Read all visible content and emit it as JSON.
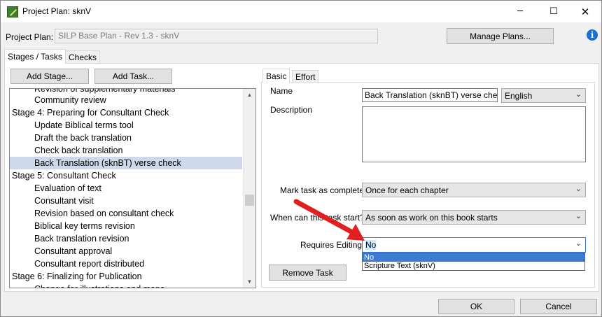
{
  "window": {
    "title": "Project Plan: sknV",
    "minimize": "─",
    "maximize": "☐",
    "close": "✕"
  },
  "project_plan": {
    "label": "Project Plan:",
    "value": "SILP Base Plan - Rev 1.3 - sknV",
    "manage_button": "Manage Plans...",
    "info_icon": "i"
  },
  "tabs": [
    {
      "label": "Stages / Tasks",
      "active": true
    },
    {
      "label": "Checks",
      "active": false
    }
  ],
  "toolbar": {
    "add_stage": "Add Stage...",
    "add_task": "Add Task..."
  },
  "tree": {
    "rows": [
      {
        "label": "Revision of supplementary materials",
        "level": 1,
        "selected": false
      },
      {
        "label": "Community review",
        "level": 1,
        "selected": false
      },
      {
        "label": "Stage 4: Preparing for Consultant Check",
        "level": 0,
        "selected": false
      },
      {
        "label": "Update Biblical terms tool",
        "level": 1,
        "selected": false
      },
      {
        "label": "Draft the back translation",
        "level": 1,
        "selected": false
      },
      {
        "label": "Check back translation",
        "level": 1,
        "selected": false
      },
      {
        "label": "Back Translation (sknBT) verse check",
        "level": 1,
        "selected": true
      },
      {
        "label": "Stage 5: Consultant Check",
        "level": 0,
        "selected": false
      },
      {
        "label": "Evaluation of text",
        "level": 1,
        "selected": false
      },
      {
        "label": "Consultant visit",
        "level": 1,
        "selected": false
      },
      {
        "label": "Revision based on consultant check",
        "level": 1,
        "selected": false
      },
      {
        "label": "Biblical key terms revision",
        "level": 1,
        "selected": false
      },
      {
        "label": "Back translation revision",
        "level": 1,
        "selected": false
      },
      {
        "label": "Consultant approval",
        "level": 1,
        "selected": false
      },
      {
        "label": "Consultant report distributed",
        "level": 1,
        "selected": false
      },
      {
        "label": "Stage 6: Finalizing for Publication",
        "level": 0,
        "selected": false
      },
      {
        "label": "Change for illustrations and maps",
        "level": 1,
        "selected": false
      }
    ],
    "scroll_up": "▲",
    "scroll_down": "▼"
  },
  "detail_tabs": [
    {
      "label": "Basic",
      "active": true
    },
    {
      "label": "Effort",
      "active": false
    }
  ],
  "detail": {
    "name_label": "Name",
    "name_value": "Back Translation (sknBT) verse check",
    "language_value": "English",
    "description_label": "Description",
    "description_value": "",
    "mark_complete_label": "Mark task as complete",
    "mark_complete_value": "Once for each chapter",
    "start_label": "When can this task start?",
    "start_value": "As soon as work on this book starts",
    "requires_editing_label": "Requires Editing",
    "requires_editing_value": "No",
    "requires_editing_options": [
      "No",
      "Scripture Text (sknV)"
    ],
    "remove_task": "Remove Task",
    "chevron": "⌄"
  },
  "footer": {
    "ok": "OK",
    "cancel": "Cancel"
  },
  "colors": {
    "selection": "#cdd8ea",
    "highlight": "#3d7bd2",
    "arrow": "#e02020"
  }
}
